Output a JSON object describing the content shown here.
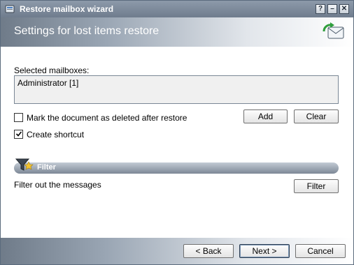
{
  "window": {
    "title": "Restore mailbox wizard"
  },
  "header": {
    "title": "Settings for lost items restore"
  },
  "mailboxes": {
    "label": "Selected mailboxes:",
    "items": [
      "Administrator [1]"
    ],
    "add_label": "Add",
    "clear_label": "Clear"
  },
  "options": {
    "mark_deleted": {
      "label": "Mark the document as deleted after restore",
      "checked": false
    },
    "create_shortcut": {
      "label": "Create shortcut",
      "checked": true
    }
  },
  "filter": {
    "section_title": "Filter",
    "description": "Filter out the messages",
    "button_label": "Filter"
  },
  "footer": {
    "back_label": "< Back",
    "next_label": "Next >",
    "cancel_label": "Cancel"
  },
  "titlebar_buttons": {
    "help": "?",
    "minimize": "–",
    "close": "✕"
  }
}
